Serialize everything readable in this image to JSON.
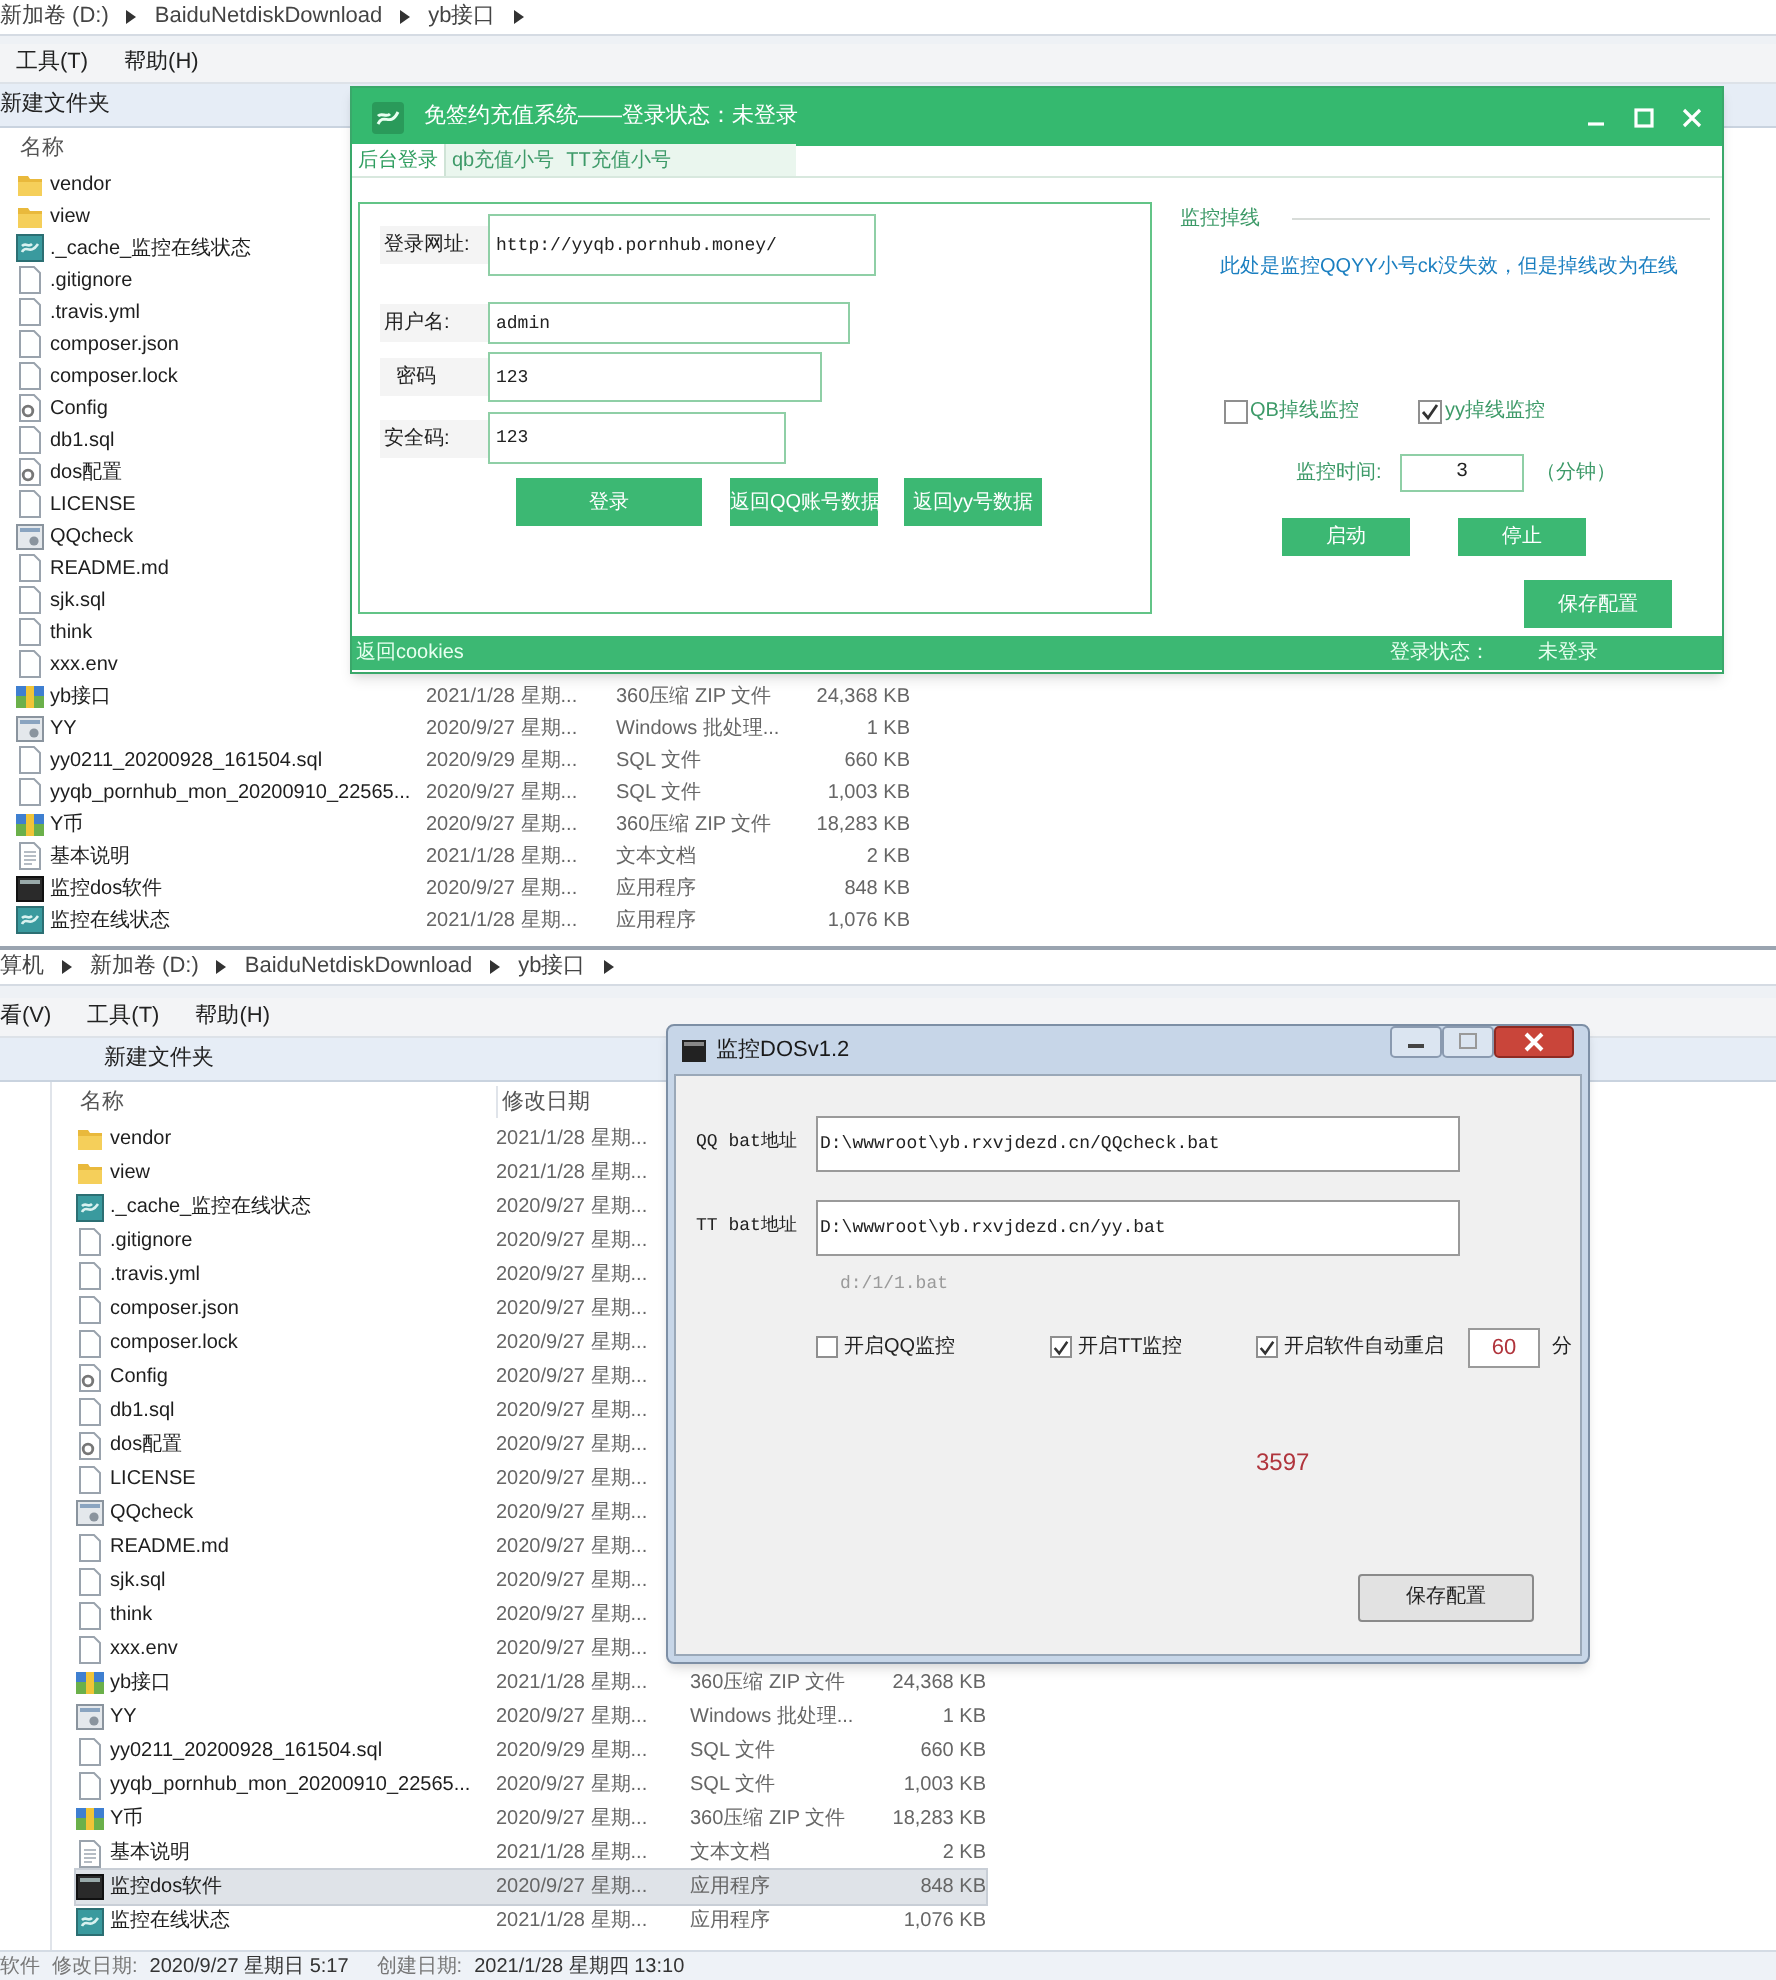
{
  "top_explorer": {
    "breadcrumb": [
      "新加卷 (D:)",
      "BaiduNetdiskDownload",
      "yb接口"
    ],
    "menu": [
      "工具(T)",
      "帮助(H)"
    ],
    "toolbar": [
      "新建文件夹"
    ],
    "columns": [
      "名称"
    ],
    "files": [
      {
        "name": "vendor",
        "kind": "folder",
        "selected": false
      },
      {
        "name": "view",
        "kind": "folder",
        "selected": false
      },
      {
        "name": "._cache_监控在线状态",
        "kind": "app",
        "selected": false
      },
      {
        "name": ".gitignore",
        "kind": "file",
        "selected": false
      },
      {
        "name": ".travis.yml",
        "kind": "file",
        "selected": false
      },
      {
        "name": "composer.json",
        "kind": "file",
        "selected": false
      },
      {
        "name": "composer.lock",
        "kind": "file",
        "selected": false
      },
      {
        "name": "Config",
        "kind": "config",
        "selected": false
      },
      {
        "name": "db1.sql",
        "kind": "file",
        "selected": false
      },
      {
        "name": "dos配置",
        "kind": "config",
        "selected": false
      },
      {
        "name": "LICENSE",
        "kind": "file",
        "selected": false
      },
      {
        "name": "QQcheck",
        "kind": "batch",
        "selected": false
      },
      {
        "name": "README.md",
        "kind": "file",
        "selected": false
      },
      {
        "name": "sjk.sql",
        "kind": "file",
        "selected": false
      },
      {
        "name": "think",
        "kind": "file",
        "selected": false
      },
      {
        "name": "xxx.env",
        "kind": "file",
        "selected": false
      },
      {
        "name": "yb接口",
        "kind": "archive",
        "date": "2021/1/28 星期...",
        "type": "360压缩 ZIP 文件",
        "size": "24,368 KB",
        "selected": false
      },
      {
        "name": "YY",
        "kind": "batch",
        "date": "2020/9/27 星期...",
        "type": "Windows 批处理...",
        "size": "1 KB",
        "selected": false
      },
      {
        "name": "yy0211_20200928_161504.sql",
        "kind": "file",
        "date": "2020/9/29 星期...",
        "type": "SQL 文件",
        "size": "660 KB",
        "selected": false
      },
      {
        "name": "yyqb_pornhub_mon_20200910_22565...",
        "kind": "file",
        "date": "2020/9/27 星期...",
        "type": "SQL 文件",
        "size": "1,003 KB",
        "selected": false
      },
      {
        "name": "Y币",
        "kind": "archive",
        "date": "2020/9/27 星期...",
        "type": "360压缩 ZIP 文件",
        "size": "18,283 KB",
        "selected": false
      },
      {
        "name": "基本说明",
        "kind": "text",
        "date": "2021/1/28 星期...",
        "type": "文本文档",
        "size": "2 KB",
        "selected": false
      },
      {
        "name": "监控dos软件",
        "kind": "darkapp",
        "date": "2020/9/27 星期...",
        "type": "应用程序",
        "size": "848 KB",
        "selected": false
      },
      {
        "name": "监控在线状态",
        "kind": "app",
        "date": "2021/1/28 星期...",
        "type": "应用程序",
        "size": "1,076 KB",
        "selected": false
      }
    ]
  },
  "recharge_window": {
    "title": "免签约充值系统——登录状态：未登录",
    "tabs": [
      {
        "label": "后台登录",
        "selected": true
      },
      {
        "label": "qb充值小号",
        "selected": false
      },
      {
        "label": "TT充值小号",
        "selected": false
      }
    ],
    "login_form": {
      "fields": [
        {
          "label": "登录网址:",
          "value": "http://yyqb.pornhub.money/"
        },
        {
          "label": "用户名:",
          "value": "admin"
        },
        {
          "label": "密码",
          "value": "123"
        },
        {
          "label": "安全码:",
          "value": "123"
        }
      ],
      "buttons": [
        "登录",
        "返回QQ账号数据",
        "返回yy号数据"
      ]
    },
    "monitor": {
      "title": "监控掉线",
      "description": "此处是监控QQYY小号ck没失效，但是掉线改为在线",
      "checkboxes": [
        {
          "label": "QB掉线监控",
          "checked": false
        },
        {
          "label": "yy掉线监控",
          "checked": true
        }
      ],
      "interval_label": "监控时间:",
      "interval_value": "3",
      "interval_unit": "（分钟）",
      "buttons": [
        "启动",
        "停止"
      ],
      "save_button": "保存配置"
    },
    "status_bar": {
      "left": "返回cookies",
      "status_label": "登录状态：",
      "status_value": "未登录"
    }
  },
  "bottom_explorer": {
    "breadcrumb": [
      "算机",
      "新加卷 (D:)",
      "BaiduNetdiskDownload",
      "yb接口"
    ],
    "menu": [
      "看(V)",
      "工具(T)",
      "帮助(H)"
    ],
    "toolbar": [
      "新建文件夹"
    ],
    "columns": [
      "名称",
      "修改日期"
    ],
    "files": [
      {
        "name": "vendor",
        "kind": "folder",
        "date": "2021/1/28 星期...",
        "selected": false
      },
      {
        "name": "view",
        "kind": "folder",
        "date": "2021/1/28 星期...",
        "selected": false
      },
      {
        "name": "._cache_监控在线状态",
        "kind": "app",
        "date": "2020/9/27 星期...",
        "selected": false
      },
      {
        "name": ".gitignore",
        "kind": "file",
        "date": "2020/9/27 星期...",
        "selected": false
      },
      {
        "name": ".travis.yml",
        "kind": "file",
        "date": "2020/9/27 星期...",
        "selected": false
      },
      {
        "name": "composer.json",
        "kind": "file",
        "date": "2020/9/27 星期...",
        "selected": false
      },
      {
        "name": "composer.lock",
        "kind": "file",
        "date": "2020/9/27 星期...",
        "selected": false
      },
      {
        "name": "Config",
        "kind": "config",
        "date": "2020/9/27 星期...",
        "selected": false
      },
      {
        "name": "db1.sql",
        "kind": "file",
        "date": "2020/9/27 星期...",
        "selected": false
      },
      {
        "name": "dos配置",
        "kind": "config",
        "date": "2020/9/27 星期...",
        "selected": false
      },
      {
        "name": "LICENSE",
        "kind": "file",
        "date": "2020/9/27 星期...",
        "selected": false
      },
      {
        "name": "QQcheck",
        "kind": "batch",
        "date": "2020/9/27 星期...",
        "selected": false
      },
      {
        "name": "README.md",
        "kind": "file",
        "date": "2020/9/27 星期...",
        "selected": false
      },
      {
        "name": "sjk.sql",
        "kind": "file",
        "date": "2020/9/27 星期...",
        "selected": false
      },
      {
        "name": "think",
        "kind": "file",
        "date": "2020/9/27 星期...",
        "selected": false
      },
      {
        "name": "xxx.env",
        "kind": "file",
        "date": "2020/9/27 星期...",
        "selected": false
      },
      {
        "name": "yb接口",
        "kind": "archive",
        "date": "2021/1/28 星期...",
        "type": "360压缩 ZIP 文件",
        "size": "24,368 KB",
        "selected": false
      },
      {
        "name": "YY",
        "kind": "batch",
        "date": "2020/9/27 星期...",
        "type": "Windows 批处理...",
        "size": "1 KB",
        "selected": false
      },
      {
        "name": "yy0211_20200928_161504.sql",
        "kind": "file",
        "date": "2020/9/29 星期...",
        "type": "SQL 文件",
        "size": "660 KB",
        "selected": false
      },
      {
        "name": "yyqb_pornhub_mon_20200910_22565...",
        "kind": "file",
        "date": "2020/9/27 星期...",
        "type": "SQL 文件",
        "size": "1,003 KB",
        "selected": false
      },
      {
        "name": "Y币",
        "kind": "archive",
        "date": "2020/9/27 星期...",
        "type": "360压缩 ZIP 文件",
        "size": "18,283 KB",
        "selected": false
      },
      {
        "name": "基本说明",
        "kind": "text",
        "date": "2021/1/28 星期...",
        "type": "文本文档",
        "size": "2 KB",
        "selected": false
      },
      {
        "name": "监控dos软件",
        "kind": "darkapp",
        "date": "2020/9/27 星期...",
        "type": "应用程序",
        "size": "848 KB",
        "selected": true
      },
      {
        "name": "监控在线状态",
        "kind": "app",
        "date": "2021/1/28 星期...",
        "type": "应用程序",
        "size": "1,076 KB",
        "selected": false
      }
    ],
    "status_bar": [
      {
        "label": "软件"
      },
      {
        "label": "修改日期:",
        "value": "2020/9/27 星期日 5:17"
      },
      {
        "label": "创建日期:",
        "value": "2021/1/28 星期四 13:10"
      }
    ]
  },
  "dos_dialog": {
    "title": "监控DOSv1.2",
    "fields": [
      {
        "label": "QQ bat地址",
        "value": "D:\\wwwroot\\yb.rxvjdezd.cn/QQcheck.bat"
      },
      {
        "label": "TT bat地址",
        "value": "D:\\wwwroot\\yb.rxvjdezd.cn/yy.bat"
      }
    ],
    "hint": "d:/1/1.bat",
    "checkboxes": [
      {
        "label": "开启QQ监控",
        "checked": false
      },
      {
        "label": "开启TT监控",
        "checked": true
      },
      {
        "label": "开启软件自动重启",
        "checked": true
      }
    ],
    "restart_minutes": "60",
    "minutes_unit": "分",
    "counter": "3597",
    "save_button": "保存配置"
  }
}
